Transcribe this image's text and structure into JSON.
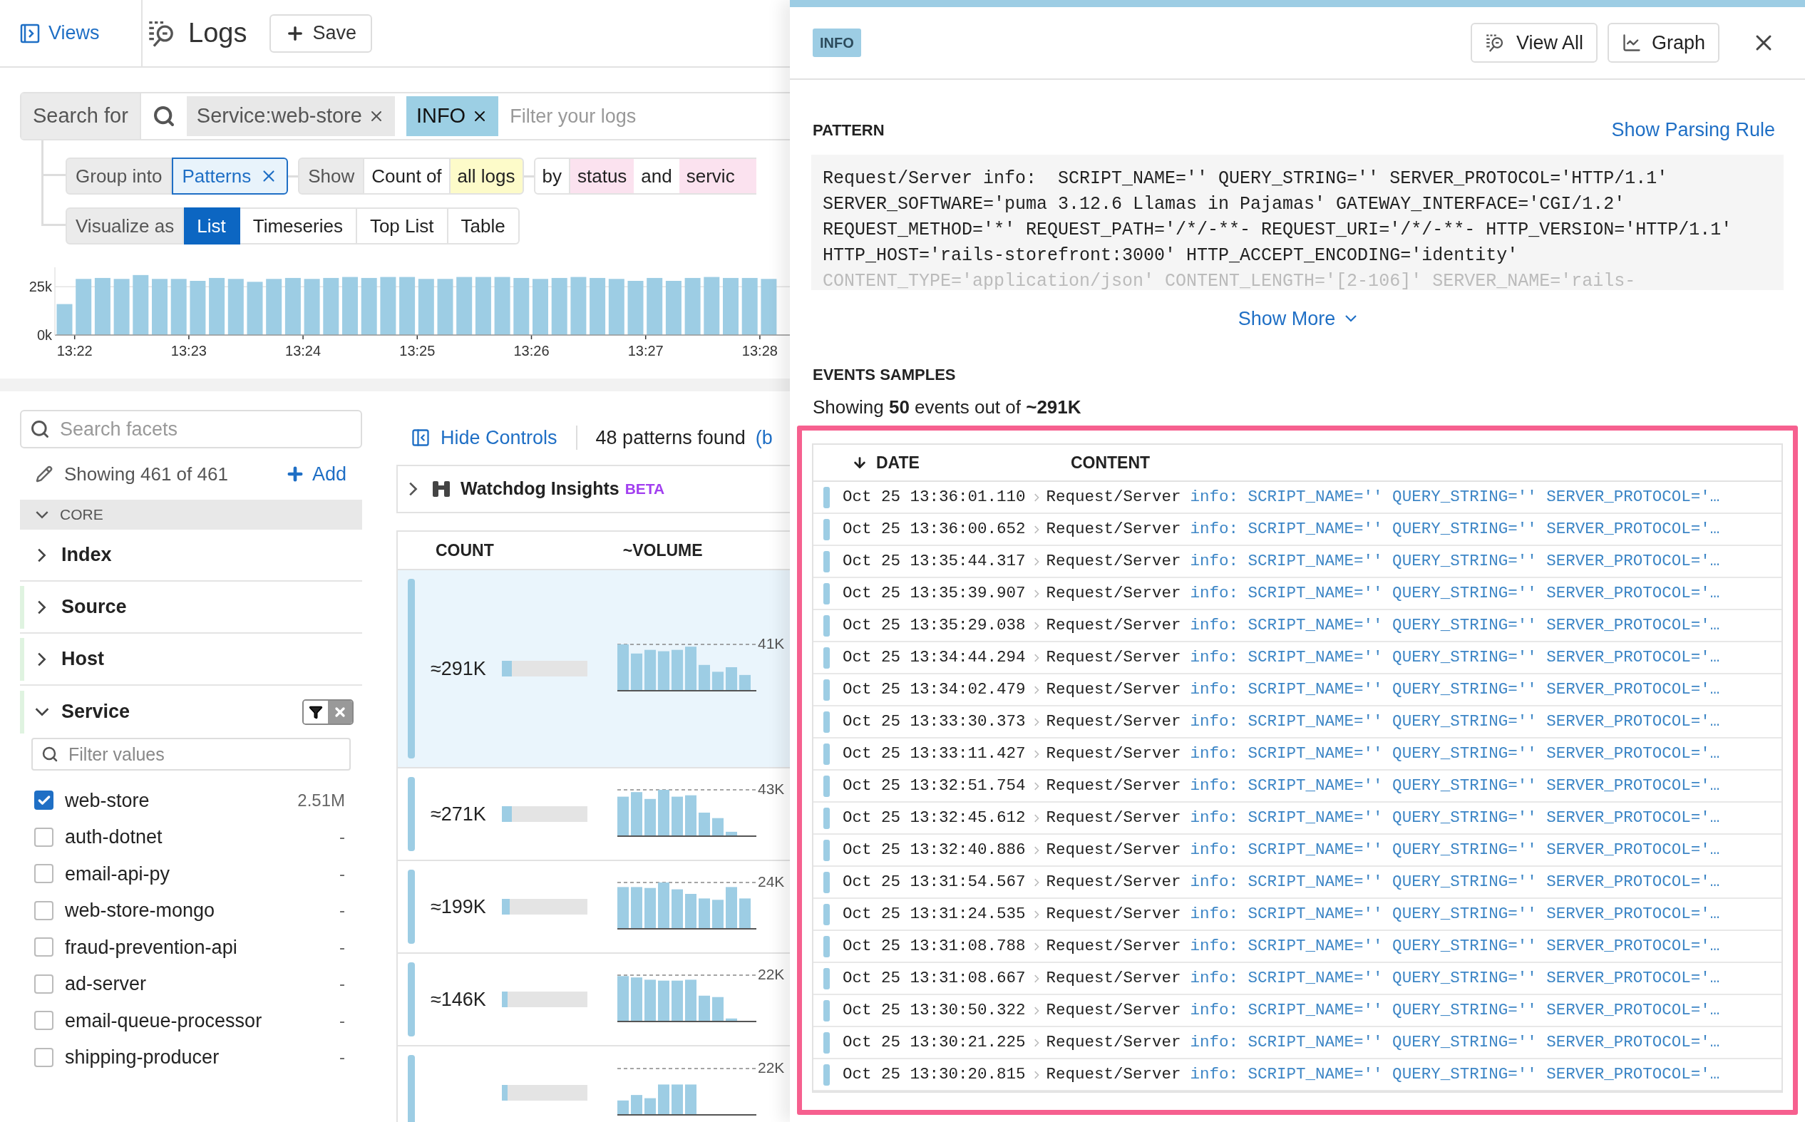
{
  "header": {
    "views": "Views",
    "title": "Logs",
    "save": "Save"
  },
  "search": {
    "label": "Search for",
    "chips": [
      {
        "text": "Service:web-store",
        "kind": "facet"
      },
      {
        "text": "INFO",
        "kind": "status"
      }
    ],
    "placeholder": "Filter your logs"
  },
  "group": {
    "label": "Group into",
    "value": "Patterns",
    "show": "Show",
    "count_of": "Count of",
    "measure": "all logs",
    "by": "by",
    "by_value": "status",
    "and": "and",
    "and_value": "servic"
  },
  "visualize": {
    "label": "Visualize as",
    "options": [
      {
        "label": "List",
        "selected": true
      },
      {
        "label": "Timeseries",
        "selected": false
      },
      {
        "label": "Top List",
        "selected": false
      },
      {
        "label": "Table",
        "selected": false
      }
    ]
  },
  "histogram": {
    "chart_data": {
      "type": "bar",
      "categories": [
        null,
        "13:22",
        null,
        null,
        null,
        null,
        null,
        "13:23",
        null,
        null,
        null,
        null,
        null,
        "13:24",
        null,
        null,
        null,
        null,
        null,
        "13:25",
        null,
        null,
        null,
        null,
        null,
        "13:26",
        null,
        null,
        null,
        null,
        null,
        "13:27",
        null,
        null,
        null,
        null,
        null,
        "13:28"
      ],
      "values": [
        16000,
        29000,
        29500,
        29000,
        31000,
        29000,
        29000,
        28000,
        29500,
        29000,
        27500,
        29000,
        29500,
        29000,
        29500,
        30000,
        29500,
        30000,
        30000,
        29000,
        29000,
        30000,
        30000,
        30000,
        29500,
        29000,
        29500,
        30000,
        29500,
        29000,
        28000,
        29500,
        28000,
        29500,
        30000,
        29500,
        29500,
        29000
      ],
      "ylim": [
        0,
        35000
      ],
      "yticks": [
        {
          "value": 0,
          "label": "0k"
        },
        {
          "value": 25000,
          "label": "25k"
        }
      ]
    }
  },
  "facets": {
    "search_placeholder": "Search facets",
    "showing": "Showing 461 of 461",
    "add": "Add",
    "section": "CORE",
    "section_expanded": true,
    "groups": [
      {
        "name": "Index",
        "expanded": false,
        "highlighted": false
      },
      {
        "name": "Source",
        "expanded": false,
        "highlighted": true
      },
      {
        "name": "Host",
        "expanded": false,
        "highlighted": true
      },
      {
        "name": "Service",
        "expanded": true,
        "highlighted": true
      }
    ],
    "filter_placeholder": "Filter values",
    "values": [
      {
        "name": "web-store",
        "count": "2.51M",
        "checked": true
      },
      {
        "name": "auth-dotnet",
        "count": "-",
        "checked": false
      },
      {
        "name": "email-api-py",
        "count": "-",
        "checked": false
      },
      {
        "name": "web-store-mongo",
        "count": "-",
        "checked": false
      },
      {
        "name": "fraud-prevention-api",
        "count": "-",
        "checked": false
      },
      {
        "name": "ad-server",
        "count": "-",
        "checked": false
      },
      {
        "name": "email-queue-processor",
        "count": "-",
        "checked": false
      },
      {
        "name": "shipping-producer",
        "count": "-",
        "checked": false
      }
    ]
  },
  "patterns": {
    "hide_controls": "Hide Controls",
    "found": "48 patterns found",
    "found_more": "(b",
    "watchdog": "Watchdog Insights",
    "watchdog_badge": "BETA",
    "columns": [
      "COUNT",
      "~VOLUME"
    ],
    "rows": [
      {
        "count": "≈291K",
        "level": 0.12,
        "max": "41K",
        "selected": true
      },
      {
        "count": "≈271K",
        "level": 0.12,
        "max": "43K",
        "selected": false
      },
      {
        "count": "≈199K",
        "level": 0.09,
        "max": "24K",
        "selected": false
      },
      {
        "count": "≈146K",
        "level": 0.07,
        "max": "22K",
        "selected": false
      },
      {
        "level": 0.07,
        "max": "22K",
        "selected": false
      }
    ]
  },
  "panel": {
    "status": "INFO",
    "buttons": [
      {
        "label": "View All",
        "kind": "view"
      },
      {
        "label": "Graph",
        "kind": "graph"
      }
    ],
    "pattern_heading": "PATTERN",
    "parsing_rule": "Show Parsing Rule",
    "pattern_lines": [
      "Request/Server info:  SCRIPT_NAME='' QUERY_STRING='' SERVER_PROTOCOL='HTTP/1.1'",
      "SERVER_SOFTWARE='puma 3.12.6 Llamas in Pajamas' GATEWAY_INTERFACE='CGI/1.2'",
      "REQUEST_METHOD='*' REQUEST_PATH='/*/-**- REQUEST_URI='/*/-**- HTTP_VERSION='HTTP/1.1'",
      "HTTP_HOST='rails-storefront:3000' HTTP_ACCEPT_ENCODING='identity'",
      "CONTENT_TYPE='application/json' CONTENT_LENGTH='[2-106]' SERVER_NAME='rails-"
    ],
    "show_more": "Show More",
    "samples_heading": "EVENTS SAMPLES",
    "samples_summary": "Showing **50** events out of **~291K**",
    "columns": [
      "DATE",
      "CONTENT"
    ],
    "events": [
      {
        "date": "Oct 25 13:36:01.110",
        "message": "Request/Server",
        "detail": "info: SCRIPT_NAME='' QUERY_STRING='' SERVER_PROTOCOL='…"
      },
      {
        "date": "Oct 25 13:36:00.652",
        "message": "Request/Server",
        "detail": "info: SCRIPT_NAME='' QUERY_STRING='' SERVER_PROTOCOL='…"
      },
      {
        "date": "Oct 25 13:35:44.317",
        "message": "Request/Server",
        "detail": "info: SCRIPT_NAME='' QUERY_STRING='' SERVER_PROTOCOL='…"
      },
      {
        "date": "Oct 25 13:35:39.907",
        "message": "Request/Server",
        "detail": "info: SCRIPT_NAME='' QUERY_STRING='' SERVER_PROTOCOL='…"
      },
      {
        "date": "Oct 25 13:35:29.038",
        "message": "Request/Server",
        "detail": "info: SCRIPT_NAME='' QUERY_STRING='' SERVER_PROTOCOL='…"
      },
      {
        "date": "Oct 25 13:34:44.294",
        "message": "Request/Server",
        "detail": "info: SCRIPT_NAME='' QUERY_STRING='' SERVER_PROTOCOL='…"
      },
      {
        "date": "Oct 25 13:34:02.479",
        "message": "Request/Server",
        "detail": "info: SCRIPT_NAME='' QUERY_STRING='' SERVER_PROTOCOL='…"
      },
      {
        "date": "Oct 25 13:33:30.373",
        "message": "Request/Server",
        "detail": "info: SCRIPT_NAME='' QUERY_STRING='' SERVER_PROTOCOL='…"
      },
      {
        "date": "Oct 25 13:33:11.427",
        "message": "Request/Server",
        "detail": "info: SCRIPT_NAME='' QUERY_STRING='' SERVER_PROTOCOL='…"
      },
      {
        "date": "Oct 25 13:32:51.754",
        "message": "Request/Server",
        "detail": "info: SCRIPT_NAME='' QUERY_STRING='' SERVER_PROTOCOL='…"
      },
      {
        "date": "Oct 25 13:32:45.612",
        "message": "Request/Server",
        "detail": "info: SCRIPT_NAME='' QUERY_STRING='' SERVER_PROTOCOL='…"
      },
      {
        "date": "Oct 25 13:32:40.886",
        "message": "Request/Server",
        "detail": "info: SCRIPT_NAME='' QUERY_STRING='' SERVER_PROTOCOL='…"
      },
      {
        "date": "Oct 25 13:31:54.567",
        "message": "Request/Server",
        "detail": "info: SCRIPT_NAME='' QUERY_STRING='' SERVER_PROTOCOL='…"
      },
      {
        "date": "Oct 25 13:31:24.535",
        "message": "Request/Server",
        "detail": "info: SCRIPT_NAME='' QUERY_STRING='' SERVER_PROTOCOL='…"
      },
      {
        "date": "Oct 25 13:31:08.788",
        "message": "Request/Server",
        "detail": "info: SCRIPT_NAME='' QUERY_STRING='' SERVER_PROTOCOL='…"
      },
      {
        "date": "Oct 25 13:31:08.667",
        "message": "Request/Server",
        "detail": "info: SCRIPT_NAME='' QUERY_STRING='' SERVER_PROTOCOL='…"
      },
      {
        "date": "Oct 25 13:30:50.322",
        "message": "Request/Server",
        "detail": "info: SCRIPT_NAME='' QUERY_STRING='' SERVER_PROTOCOL='…"
      },
      {
        "date": "Oct 25 13:30:21.225",
        "message": "Request/Server",
        "detail": "info: SCRIPT_NAME='' QUERY_STRING='' SERVER_PROTOCOL='…"
      },
      {
        "date": "Oct 25 13:30:20.815",
        "message": "Request/Server",
        "detail": "info: SCRIPT_NAME='' QUERY_STRING='' SERVER_PROTOCOL='…"
      }
    ]
  }
}
